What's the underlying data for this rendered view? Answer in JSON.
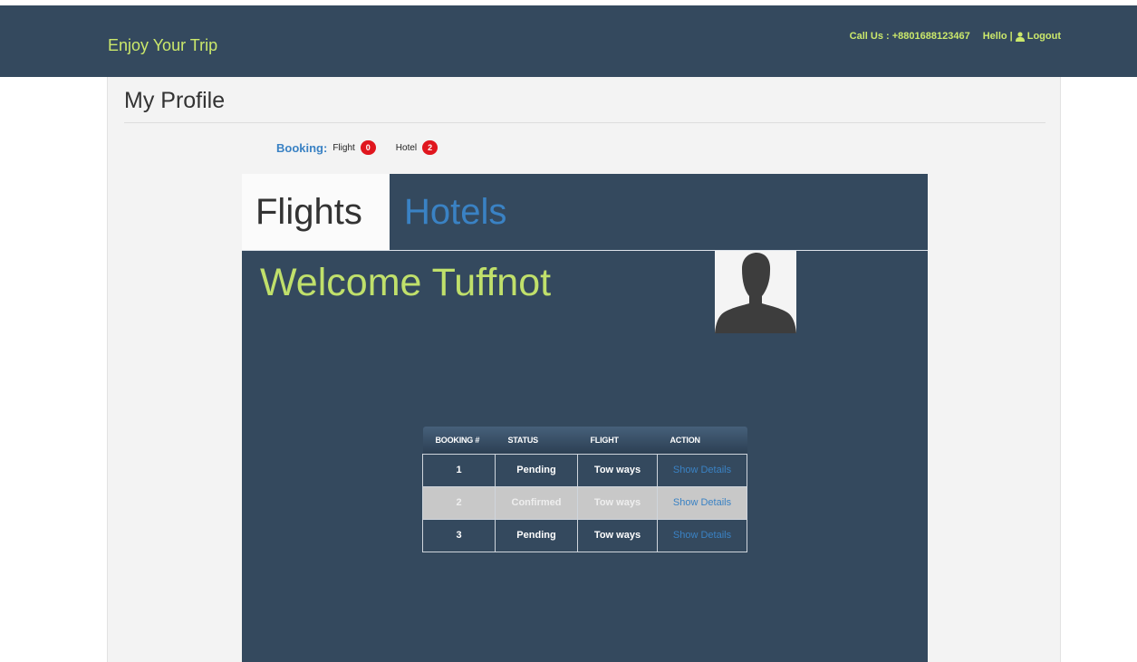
{
  "header": {
    "brand": "Enjoy Your Trip",
    "call_us": "Call Us : +8801688123467",
    "hello": "Hello |",
    "logout": "Logout"
  },
  "page": {
    "title": "My Profile"
  },
  "booking": {
    "label": "Booking:",
    "flight_label": "Flight",
    "flight_count": "0",
    "hotel_label": "Hotel",
    "hotel_count": "2"
  },
  "tabs": {
    "flights": "Flights",
    "hotels": "Hotels"
  },
  "welcome": "Welcome Tuffnot",
  "table": {
    "headers": [
      "BOOKING #",
      "STATUS",
      "FLIGHT",
      "ACTION"
    ],
    "rows": [
      {
        "booking": "1",
        "status": "Pending",
        "flight": "Tow ways",
        "action": "Show Details"
      },
      {
        "booking": "2",
        "status": "Confirmed",
        "flight": "Tow ways",
        "action": "Show Details"
      },
      {
        "booking": "3",
        "status": "Pending",
        "flight": "Tow ways",
        "action": "Show Details"
      }
    ]
  },
  "colors": {
    "header_bg": "#34495e",
    "accent_green": "#cbe86b",
    "link_blue": "#3a82c4",
    "badge_red": "#e0161e"
  }
}
